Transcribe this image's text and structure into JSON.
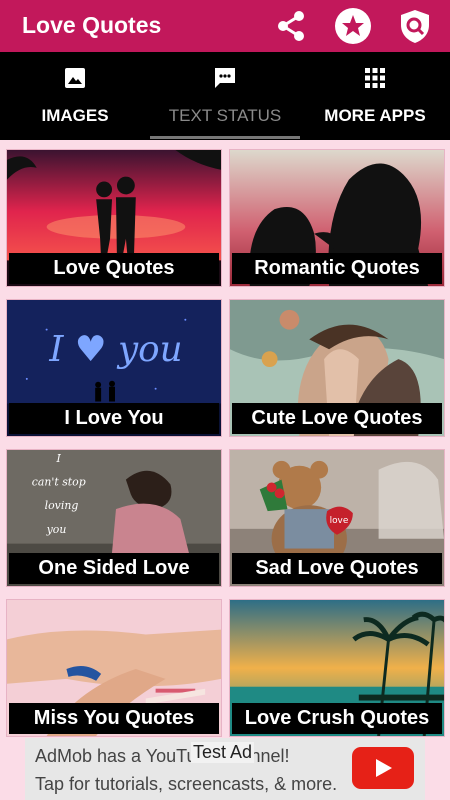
{
  "app": {
    "title": "Love Quotes",
    "actions": [
      {
        "name": "share-icon"
      },
      {
        "name": "star-icon"
      },
      {
        "name": "shield-search-icon"
      }
    ]
  },
  "tabs": [
    {
      "label": "IMAGES",
      "icon": "image-icon",
      "active": false
    },
    {
      "label": "TEXT STATUS",
      "icon": "chat-icon",
      "active": true
    },
    {
      "label": "MORE APPS",
      "icon": "apps-grid-icon",
      "active": false
    }
  ],
  "cards": [
    {
      "label": "Love Quotes"
    },
    {
      "label": "Romantic Quotes"
    },
    {
      "label": "I Love You",
      "image_text": "I ♥ you"
    },
    {
      "label": "Cute Love Quotes"
    },
    {
      "label": "One Sided Love",
      "image_text": [
        "I",
        "can't stop",
        "loving",
        "you"
      ]
    },
    {
      "label": "Sad Love Quotes",
      "image_text": "love"
    },
    {
      "label": "Miss You Quotes"
    },
    {
      "label": "Love Crush Quotes"
    }
  ],
  "ad": {
    "line1": "AdMob has a YouTube channel!",
    "line2": "Tap for tutorials, screencasts, & more.",
    "test_label": "Test Ad"
  },
  "colors": {
    "primary": "#c2185b",
    "tabs_bg": "#000000",
    "page_bg": "#fbdce7",
    "ad_button": "#e62117"
  }
}
